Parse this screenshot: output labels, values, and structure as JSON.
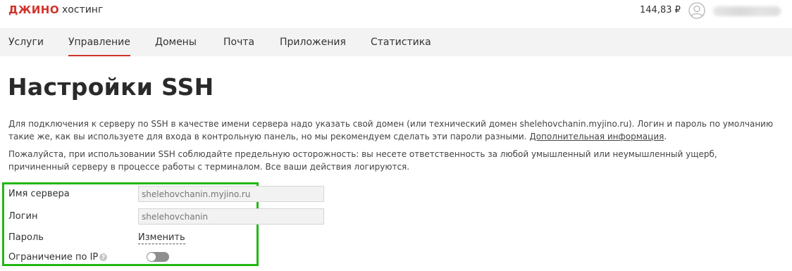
{
  "header": {
    "logo": "ДЖИНО",
    "logo_subtitle": "хостинг",
    "balance": "144,83 ₽",
    "avatar_icon": "user-circle-icon"
  },
  "nav": {
    "items": [
      {
        "label": "Услуги",
        "active": false
      },
      {
        "label": "Управление",
        "active": true
      },
      {
        "label": "Домены",
        "active": false
      },
      {
        "label": "Почта",
        "active": false
      },
      {
        "label": "Приложения",
        "active": false
      },
      {
        "label": "Статистика",
        "active": false
      }
    ],
    "accent_color": "#d0342c"
  },
  "main": {
    "title": "Настройки SSH",
    "paragraph1_text": "Для подключения к серверу по SSH в качестве имени сервера надо указать свой домен (или технический домен shelehovchanin.myjino.ru). Логин и пароль по умолчанию такие же, как вы используете для входа в контрольную панель, но мы рекомендуем сделать эти пароли разными.",
    "paragraph1_link": "Дополнительная информация",
    "paragraph1_end": ".",
    "paragraph2": "Пожалуйста, при использовании SSH соблюдайте предельную осторожность: вы несете ответственность за любой умышленный или неумышленный ущерб, причиненный серверу в процессе работы с терминалом. Все ваши действия логируются."
  },
  "form": {
    "server_name_label": "Имя сервера",
    "server_name_placeholder": "shelehovchanin.myjino.ru",
    "login_label": "Логин",
    "login_placeholder": "shelehovchanin",
    "password_label": "Пароль",
    "password_change_link": "Изменить",
    "ip_limit_label": "Ограничение по IP",
    "ip_limit_help_icon": "question-circle-icon",
    "ip_limit_enabled": false,
    "highlight_color": "#22b814"
  }
}
